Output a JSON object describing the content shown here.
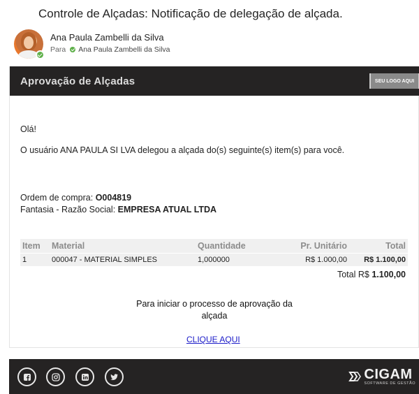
{
  "subject": "Controle de Alçadas: Notificação de delegação de alçada.",
  "sender": {
    "name": "Ana Paula Zambelli da Silva",
    "to_label": "Para",
    "recipient": "Ana Paula Zambelli da Silva"
  },
  "email": {
    "header_title": "Aprovação de Alçadas",
    "logo_placeholder": "SEU LOGO AQUI",
    "greeting": "Olá!",
    "message": "O usuário ANA PAULA SI LVA delegou a alçada do(s) seguinte(s) item(s) para você.",
    "order_label": "Ordem de compra: ",
    "order_value": "O004819",
    "company_label": "Fantasia - Razão Social: ",
    "company_value": "EMPRESA ATUAL LTDA",
    "table": {
      "headers": [
        "Item",
        "Material",
        "Quantidade",
        "Pr. Unitário",
        "Total"
      ],
      "rows": [
        [
          "1",
          "000047 - MATERIAL SIMPLES",
          "1,000000",
          "R$ 1.000,00",
          "R$ 1.100,00"
        ]
      ],
      "total_label": "Total R$ ",
      "total_value": "1.100,00"
    },
    "cta_text": "Para iniciar o processo de aprovação da alçada",
    "cta_link": "CLIQUE AQUI"
  },
  "footer": {
    "social": [
      "facebook-icon",
      "instagram-icon",
      "linkedin-icon",
      "twitter-icon"
    ],
    "brand_name": "CIGAM",
    "brand_sub": "SOFTWARE DE GESTÃO"
  },
  "colors": {
    "dark_bar": "#252323",
    "link": "#1a1ac8",
    "presence": "#5fb04a",
    "table_bg": "#f0f0f0"
  }
}
